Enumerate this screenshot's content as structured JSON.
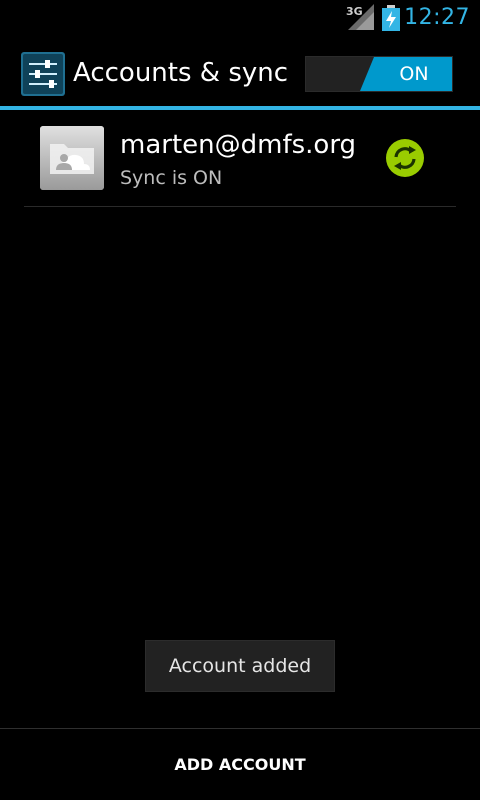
{
  "status_bar": {
    "network": "3G",
    "signal_icon": "signal-icon",
    "battery_icon": "battery-charging-icon",
    "time": "12:27",
    "time_color": "#33b5e5"
  },
  "action_bar": {
    "icon": "settings-sliders-icon",
    "title": "Accounts & sync",
    "toggle_label": "ON",
    "toggle_state": true,
    "accent_color": "#33b5e5"
  },
  "accounts": [
    {
      "avatar_icon": "cloud-contact-icon",
      "email": "marten@dmfs.org",
      "status": "Sync is ON",
      "sync_icon": "sync-active-icon",
      "sync_color": "#99cc00"
    }
  ],
  "toast": {
    "text": "Account added"
  },
  "bottom_bar": {
    "add_account_label": "ADD ACCOUNT"
  }
}
